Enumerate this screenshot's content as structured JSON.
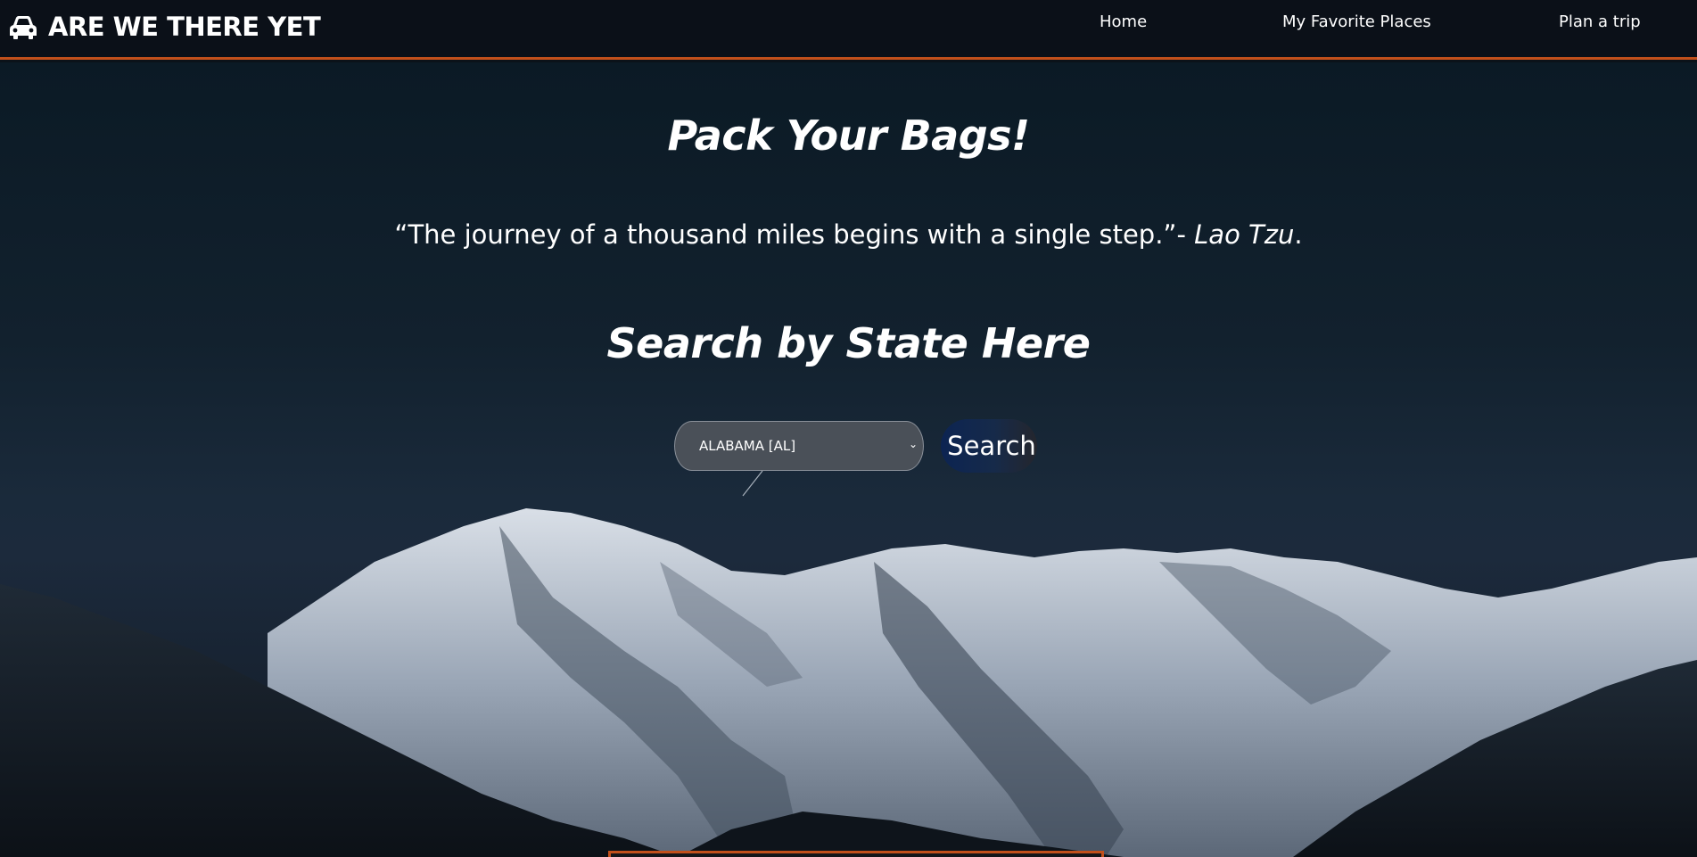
{
  "header": {
    "brand_title": "ARE WE THERE YET",
    "brand_icon": "car-icon",
    "nav": [
      {
        "label": "Home"
      },
      {
        "label": "My Favorite Places"
      },
      {
        "label": "Plan a trip"
      }
    ]
  },
  "hero": {
    "headline": "Pack Your Bags!",
    "quote_text": "“The journey of a thousand miles begins with a single step.”- ",
    "quote_author": "Lao Tzu",
    "quote_end": ".",
    "search_heading": "Search by State Here",
    "state_select": {
      "selected": "ALABAMA [AL]"
    },
    "search_button_label": "Search"
  },
  "colors": {
    "accent": "#c2501b",
    "navbar_bg": "#0b1018",
    "text": "#ffffff"
  }
}
